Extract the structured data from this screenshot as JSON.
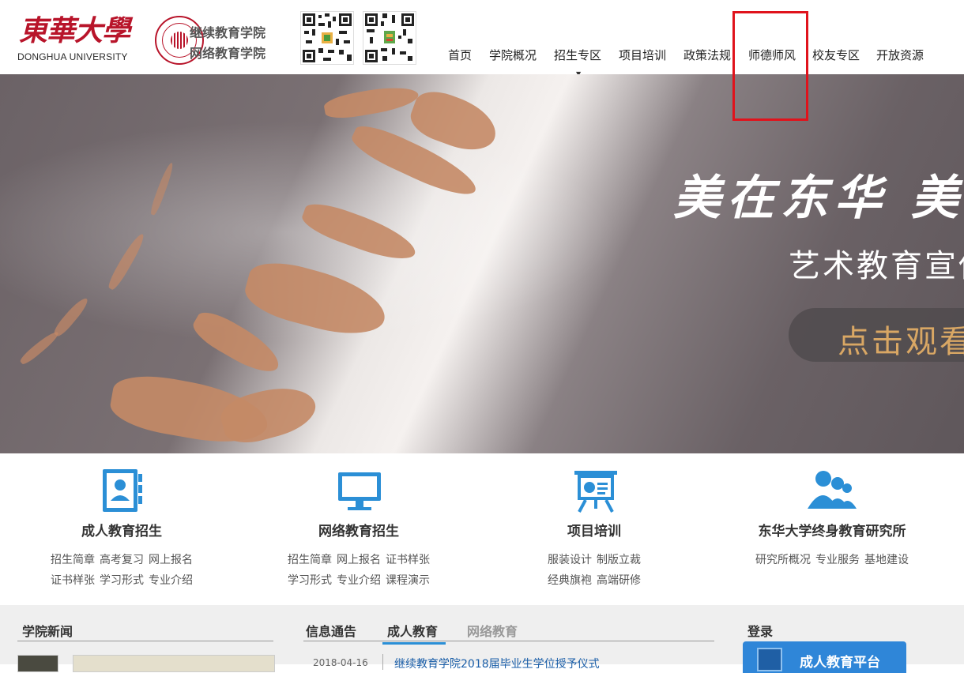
{
  "header": {
    "logo_cn": "東華大學",
    "logo_en": "DONGHUA UNIVERSITY",
    "college_line1": "继续教育学院",
    "college_line2": "网络教育学院"
  },
  "nav": {
    "items": [
      {
        "label": "首页"
      },
      {
        "label": "学院概况"
      },
      {
        "label": "招生专区"
      },
      {
        "label": "项目培训"
      },
      {
        "label": "政策法规"
      },
      {
        "label": "师德师风"
      },
      {
        "label": "校友专区"
      },
      {
        "label": "开放资源"
      }
    ],
    "dropdown_caret": "▼"
  },
  "banner": {
    "calligraphy": "美在东华 美",
    "subtitle": "艺术教育宣传",
    "button_label": "点击观看"
  },
  "features": [
    {
      "title": "成人教育招生",
      "icon": "contact-book-icon",
      "links_row1": [
        "招生简章",
        "高考复习",
        "网上报名"
      ],
      "links_row2": [
        "证书样张",
        "学习形式",
        "专业介绍"
      ]
    },
    {
      "title": "网络教育招生",
      "icon": "monitor-icon",
      "links_row1": [
        "招生简章",
        "网上报名",
        "证书样张"
      ],
      "links_row2": [
        "学习形式",
        "专业介绍",
        "课程演示"
      ]
    },
    {
      "title": "项目培训",
      "icon": "presentation-board-icon",
      "links_row1": [
        "服装设计",
        "制版立裁"
      ],
      "links_row2": [
        "经典旗袍",
        "高端研修"
      ]
    },
    {
      "title": "东华大学终身教育研究所",
      "icon": "users-group-icon",
      "links_row1": [
        "研究所概况",
        "专业服务",
        "基地建设"
      ],
      "links_row2": []
    }
  ],
  "bottom": {
    "news_title": "学院新闻",
    "notice_tabs": [
      {
        "label": "信息通告"
      },
      {
        "label": "成人教育"
      },
      {
        "label": "网络教育"
      }
    ],
    "first_notice": {
      "date": "2018-04-16",
      "title": "继续教育学院2018届毕业生学位授予仪式"
    },
    "login_title": "登录",
    "login_button": "成人教育平台"
  },
  "colors": {
    "brand_red": "#b8142a",
    "accent_blue": "#2b8fd6",
    "highlight_red": "#e0131c"
  }
}
